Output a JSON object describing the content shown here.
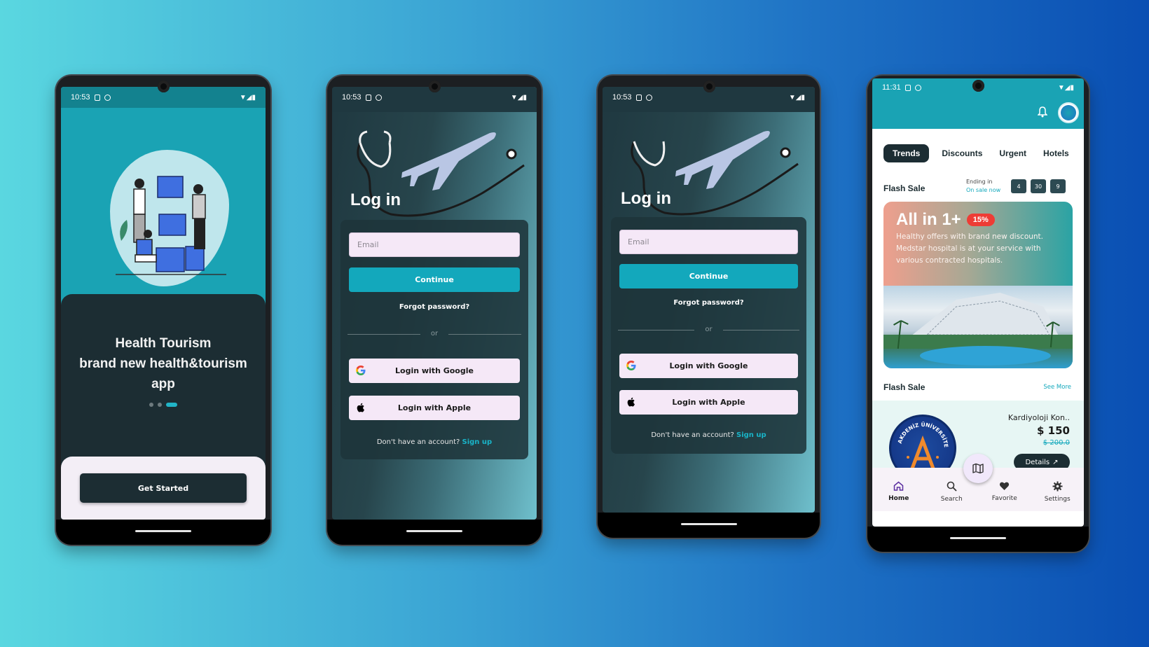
{
  "colors": {
    "teal": "#1aa3b4",
    "dark": "#1c2d33",
    "cyan": "#13a8bc",
    "sale_red": "#ee3c35"
  },
  "phone1": {
    "status_time": "10:53",
    "title_line1": "Health Tourism",
    "title_line2": "brand new health&tourism",
    "title_line3": "app",
    "button": "Get Started",
    "page_indicator": {
      "count": 3,
      "active_index": 2
    }
  },
  "phone2": {
    "status_time": "10:53",
    "title": "Log in",
    "email_placeholder": "Email",
    "continue": "Continue",
    "forgot": "Forgot password?",
    "or": "or",
    "google": "Login with Google",
    "apple": "Login with Apple",
    "no_account": "Don't have an account?",
    "signup": "Sign up"
  },
  "phone3": {
    "status_time": "10:53",
    "title": "Log in",
    "email_placeholder": "Email",
    "continue": "Continue",
    "forgot": "Forgot password?",
    "or": "or",
    "google": "Login with Google",
    "apple": "Login with Apple",
    "no_account": "Don't have an account?",
    "signup": "Sign up"
  },
  "phone4": {
    "status_time": "11:31",
    "tabs": [
      "Trends",
      "Discounts",
      "Urgent",
      "Hotels"
    ],
    "flash_sale": "Flash Sale",
    "ending_label": "Ending in",
    "on_sale": "On sale now",
    "timer": [
      "4",
      "30",
      "9"
    ],
    "promo_title": "All in 1+",
    "promo_badge": "15%",
    "promo_text": "Healthy offers with brand new discount. Medstar hospital is at your service with various contracted hospitals.",
    "flash_sale_2": "Flash Sale",
    "see_more": "See More",
    "product_name": "Kardiyoloji Kon..",
    "price": "$ 150",
    "old_price": "$ 200.0",
    "details": "Details",
    "logo_text": "AKDENİZ ÜNİVERSİTESİ",
    "nav": [
      "Home",
      "Search",
      "Favorite",
      "Settings"
    ]
  }
}
